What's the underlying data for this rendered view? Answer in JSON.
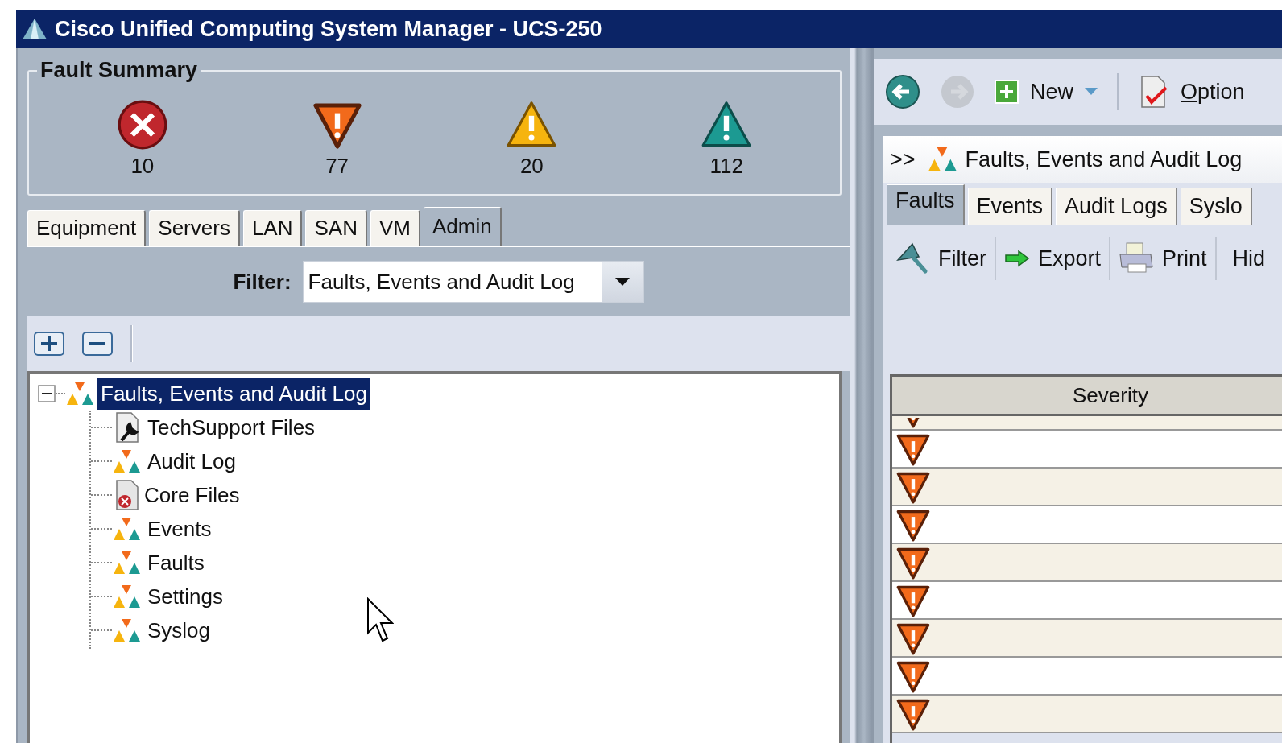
{
  "window": {
    "title": "Cisco Unified Computing System Manager - UCS-250"
  },
  "fault_summary": {
    "title": "Fault Summary",
    "items": [
      {
        "kind": "critical",
        "count": "10"
      },
      {
        "kind": "major",
        "count": "77"
      },
      {
        "kind": "minor",
        "count": "20"
      },
      {
        "kind": "warning",
        "count": "112"
      }
    ]
  },
  "nav_tabs": [
    {
      "label": "Equipment",
      "selected": false
    },
    {
      "label": "Servers",
      "selected": false
    },
    {
      "label": "LAN",
      "selected": false
    },
    {
      "label": "SAN",
      "selected": false
    },
    {
      "label": "VM",
      "selected": false
    },
    {
      "label": "Admin",
      "selected": true
    }
  ],
  "filter": {
    "label": "Filter:",
    "value": "Faults, Events and Audit Log"
  },
  "tree": [
    {
      "label": "Faults, Events and Audit Log",
      "kind": "faults",
      "selected": true,
      "expanded": true,
      "children": [
        {
          "label": "TechSupport Files",
          "kind": "techsupport",
          "selected": false
        },
        {
          "label": "Audit Log",
          "kind": "faults",
          "selected": false
        },
        {
          "label": "Core Files",
          "kind": "corefile",
          "selected": false
        },
        {
          "label": "Events",
          "kind": "faults",
          "selected": false
        },
        {
          "label": "Faults",
          "kind": "faults",
          "selected": false
        },
        {
          "label": "Settings",
          "kind": "faults",
          "selected": false
        },
        {
          "label": "Syslog",
          "kind": "faults",
          "selected": false
        }
      ]
    }
  ],
  "toolbar": {
    "new_label": "New",
    "options_label": "Option",
    "back_disabled": false,
    "forward_disabled": true
  },
  "breadcrumb": {
    "prefix": ">>",
    "label": "Faults, Events and Audit Log"
  },
  "content_tabs": [
    {
      "label": "Faults",
      "selected": true
    },
    {
      "label": "Events",
      "selected": false
    },
    {
      "label": "Audit Logs",
      "selected": false
    },
    {
      "label": "Syslo",
      "selected": false
    }
  ],
  "actions": [
    {
      "kind": "filter",
      "label": "Filter"
    },
    {
      "kind": "export",
      "label": "Export"
    },
    {
      "kind": "print",
      "label": "Print"
    },
    {
      "kind": "hide",
      "label": "Hid"
    }
  ],
  "table": {
    "columns": [
      "Severity"
    ],
    "rows": [
      {
        "kind": "major",
        "partial": true
      },
      {
        "kind": "major",
        "partial": false
      },
      {
        "kind": "major",
        "partial": false
      },
      {
        "kind": "major",
        "partial": false
      },
      {
        "kind": "major",
        "partial": false
      },
      {
        "kind": "major",
        "partial": false
      },
      {
        "kind": "major",
        "partial": false
      },
      {
        "kind": "major",
        "partial": false
      },
      {
        "kind": "major",
        "partial": false
      }
    ]
  }
}
